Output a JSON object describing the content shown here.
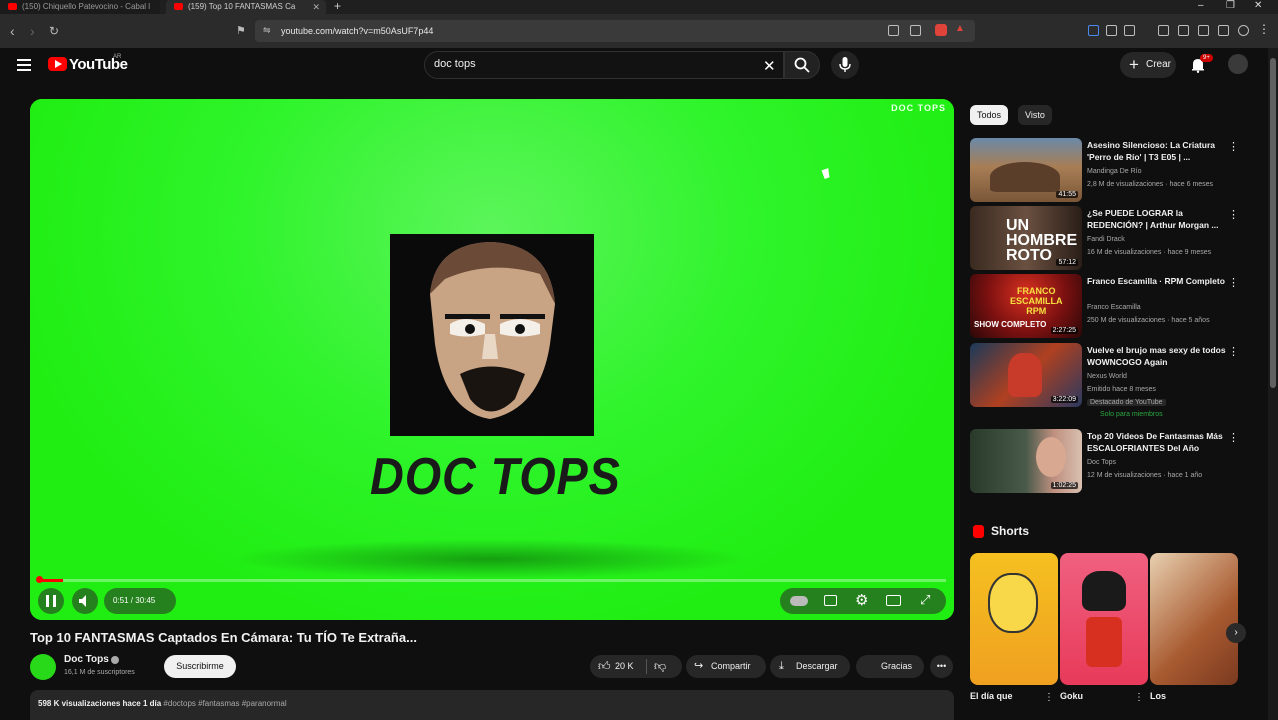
{
  "browser": {
    "tabs": [
      {
        "label": "(150) Chiquello Patevocino - Cabal l"
      },
      {
        "label": "(159) Top 10 FANTASMAS Ca"
      }
    ],
    "url": "youtube.com/watch?v=m50AsUF7p44"
  },
  "header": {
    "logo": "YouTube",
    "country": "AR",
    "search_value": "doc tops",
    "create_label": "Crear",
    "notif_count": "9+"
  },
  "player": {
    "watermark": "DOC TOPS",
    "brand_title": "DOC TOPS",
    "time": "0:51 / 30:45",
    "progress_fraction": 0.028
  },
  "video": {
    "title": "Top 10 FANTASMAS Captados En Cámara: Tu TÍO Te Extraña...",
    "channel": "Doc Tops",
    "subscribers": "16,1 M de suscriptores",
    "subscribe_label": "Suscribirme",
    "likes": "20 K",
    "share_label": "Compartir",
    "download_label": "Descargar",
    "thanks_label": "Gracias",
    "views_line": "598 K visualizaciones  hace 1 día",
    "tags": "#doctops #fantasmas #paranormal"
  },
  "sidebar": {
    "chips": [
      "Todos",
      "Visto"
    ],
    "recommendations": [
      {
        "title": "Asesino Silencioso: La Criatura 'Perro de Río' | T3 E05 | ...",
        "channel": "Mandinga De Río",
        "meta": "2,8 M de visualizaciones · hace 6 meses",
        "duration": "41:55",
        "thumb_color": "#8a6a4a"
      },
      {
        "title": "¿Se PUEDE LOGRAR la REDENCIÓN? | Arthur Morgan ...",
        "channel": "Fandi Drack",
        "meta": "16 M de visualizaciones · hace 9 meses",
        "duration": "57:12",
        "thumb_color": "#3a2a20"
      },
      {
        "title": "Franco Escamilla · RPM Completo",
        "channel": "Franco Escamilla",
        "meta": "250 M de visualizaciones · hace 5 años",
        "duration": "2:27:25",
        "thumb_color": "#7a1010"
      },
      {
        "title": "Vuelve el brujo mas sexy de todos WOWNCOGO Again",
        "channel": "Nexus World",
        "meta": "Emitido hace 8 meses",
        "duration": "3:22:09",
        "thumb_color": "#1a3a5a",
        "badge": "Destacado de YouTube",
        "extra": "Solo para miembros"
      },
      {
        "title": "Top 20 Videos De Fantasmas Más ESCALOFRIANTES Del Año",
        "channel": "Doc Tops",
        "meta": "12 M de visualizaciones · hace 1 año",
        "duration": "1:02:25",
        "thumb_color": "#3a4a3a"
      }
    ],
    "shorts_label": "Shorts",
    "shorts": [
      {
        "title": "El día que",
        "color": "#f5c020"
      },
      {
        "title": "Goku",
        "color": "#f04a60"
      },
      {
        "title": "Los",
        "color": "#c08a60"
      }
    ]
  },
  "colors": {
    "accent": "#ff0000",
    "green_screen": "#26f21a"
  }
}
